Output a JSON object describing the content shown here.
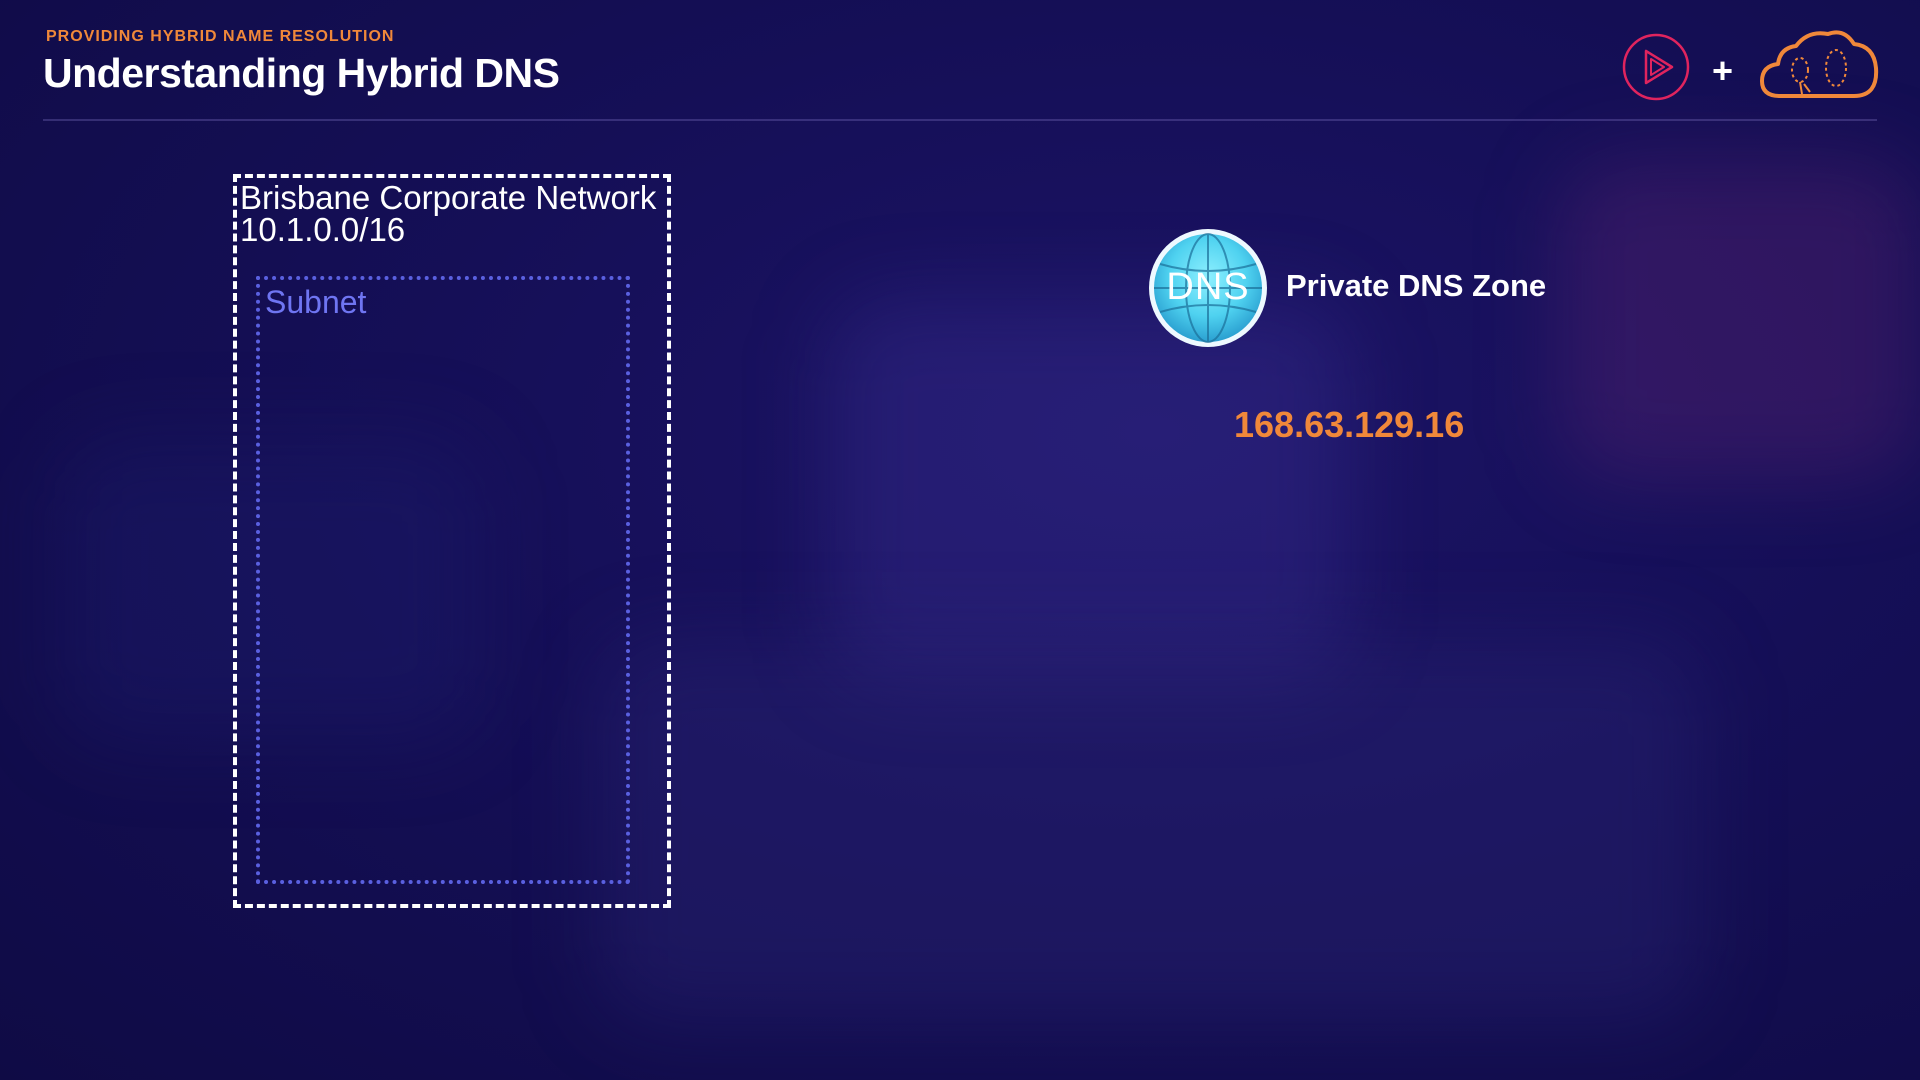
{
  "header": {
    "eyebrow": "PROVIDING HYBRID NAME RESOLUTION",
    "title": "Understanding Hybrid DNS",
    "plus": "+"
  },
  "logos": {
    "play_logo": "play-logo-icon",
    "cloud_logo": "cloud-logo-icon"
  },
  "network": {
    "name": "Brisbane Corporate Network",
    "cidr": "10.1.0.0/16",
    "subnet_label": "Subnet"
  },
  "dns": {
    "icon_text": "DNS",
    "zone_label": "Private DNS Zone",
    "ip": "168.63.129.16"
  },
  "colors": {
    "background": "#150f57",
    "accent_orange": "#f0883a",
    "subnet_blue": "#6f75f2",
    "play_logo_red": "#e0245e",
    "dns_globe": "#4fd2f0"
  }
}
